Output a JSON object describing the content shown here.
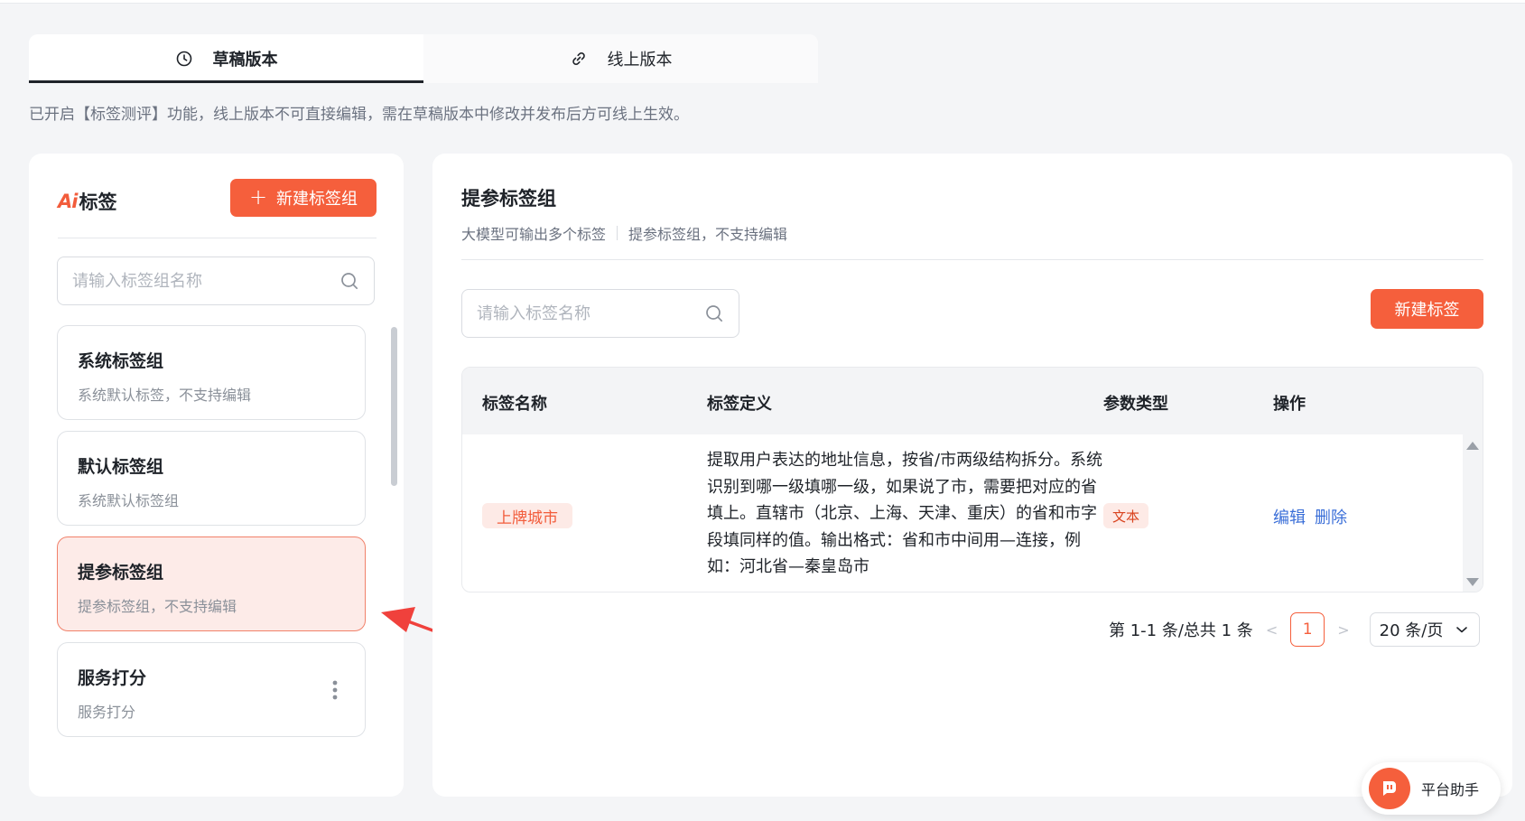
{
  "tabs": {
    "draft_label": "草稿版本",
    "online_label": "线上版本"
  },
  "notice": "已开启【标签测评】功能，线上版本不可直接编辑，需在草稿版本中修改并发布后方可线上生效。",
  "left_panel": {
    "title": "标签",
    "logo_text": "Ai",
    "new_group_label": "新建标签组",
    "search_placeholder": "请输入标签组名称",
    "groups": [
      {
        "title": "系统标签组",
        "desc": "系统默认标签，不支持编辑"
      },
      {
        "title": "默认标签组",
        "desc": "系统默认标签组"
      },
      {
        "title": "提参标签组",
        "desc": "提参标签组，不支持编辑",
        "selected": true
      },
      {
        "title": "服务打分",
        "desc": "服务打分"
      }
    ]
  },
  "right_panel": {
    "title": "提参标签组",
    "sub1": "大模型可输出多个标签",
    "sub2": "提参标签组，不支持编辑",
    "search_placeholder": "请输入标签名称",
    "new_tag_label": "新建标签",
    "table": {
      "headers": [
        "标签名称",
        "标签定义",
        "参数类型",
        "操作"
      ],
      "rows": [
        {
          "name": "上牌城市",
          "definition": "提取用户表达的地址信息，按省/市两级结构拆分。系统识别到哪一级填哪一级，如果说了市，需要把对应的省填上。直辖市（北京、上海、天津、重庆）的省和市字段填同样的值。输出格式：省和市中间用—连接，例如：河北省—秦皇岛市",
          "type": "文本",
          "edit": "编辑",
          "delete": "删除"
        }
      ]
    },
    "pagination": {
      "summary": "第 1-1 条/总共 1 条",
      "current_page": "1",
      "page_size": "20 条/页"
    }
  },
  "helper": {
    "label": "平台助手"
  }
}
